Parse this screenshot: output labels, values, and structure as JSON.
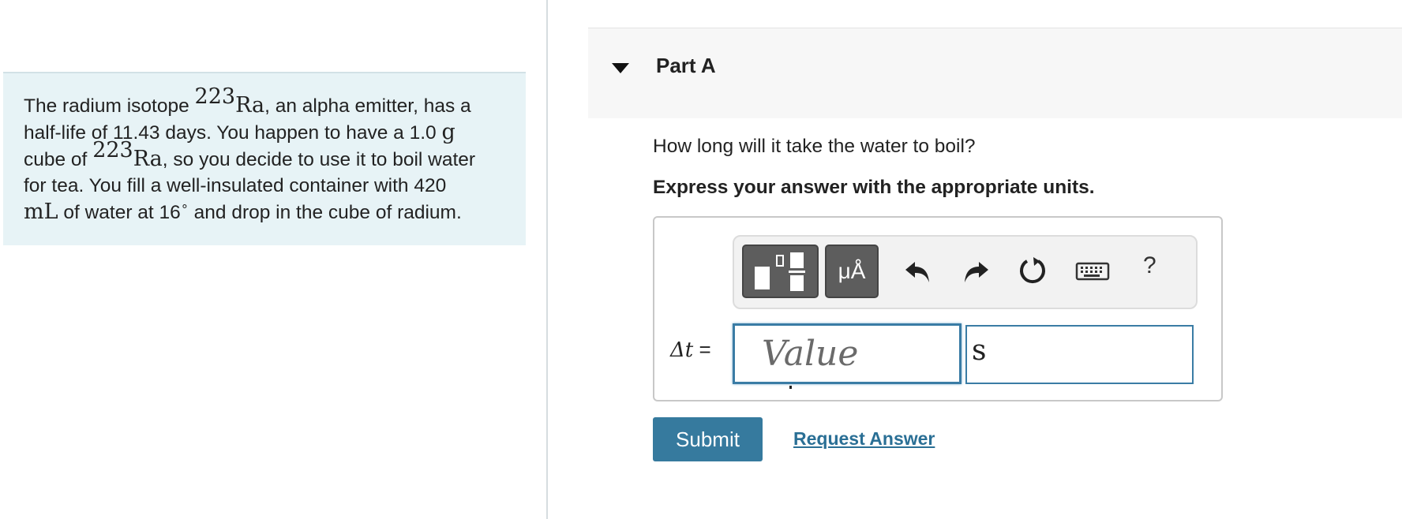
{
  "problem": {
    "line1_a": "The radium isotope ",
    "iso_mass_1": "223",
    "iso_symbol_1": "Ra",
    "line1_b": ", an alpha emitter, has a",
    "line2_a": "half-life of 11.43 days. You happen to have a 1.0 ",
    "line2_unit": "g",
    "line3_a": "cube of ",
    "iso_mass_2": "223",
    "iso_symbol_2": "Ra",
    "line3_b": ", so you decide to use it to boil water",
    "line4": "for tea. You fill a well-insulated container with 420",
    "line5_unit": "mL",
    "line5_a": " of water at 16",
    "line5_deg": "∘",
    "line5_b": "  and drop in the cube of radium."
  },
  "part": {
    "title": "Part A",
    "question": "How long will it take the water to boil?",
    "instruction": "Express your answer with the appropriate units."
  },
  "toolbar": {
    "templates_icon": "templates-icon",
    "symbols_label": "μÅ",
    "undo_icon": "undo-icon",
    "redo_icon": "redo-icon",
    "reset_icon": "reset-icon",
    "keyboard_icon": "keyboard-icon",
    "help_label": "?"
  },
  "answer": {
    "variable": "Δt",
    "equals": " =",
    "value_placeholder": "Value",
    "unit": "s"
  },
  "actions": {
    "submit_label": "Submit",
    "request_label": "Request Answer"
  },
  "colors": {
    "panel_bg": "#e7f3f6",
    "accent": "#367a9e",
    "link": "#2a6f95",
    "input_border": "#3a7ca5"
  }
}
